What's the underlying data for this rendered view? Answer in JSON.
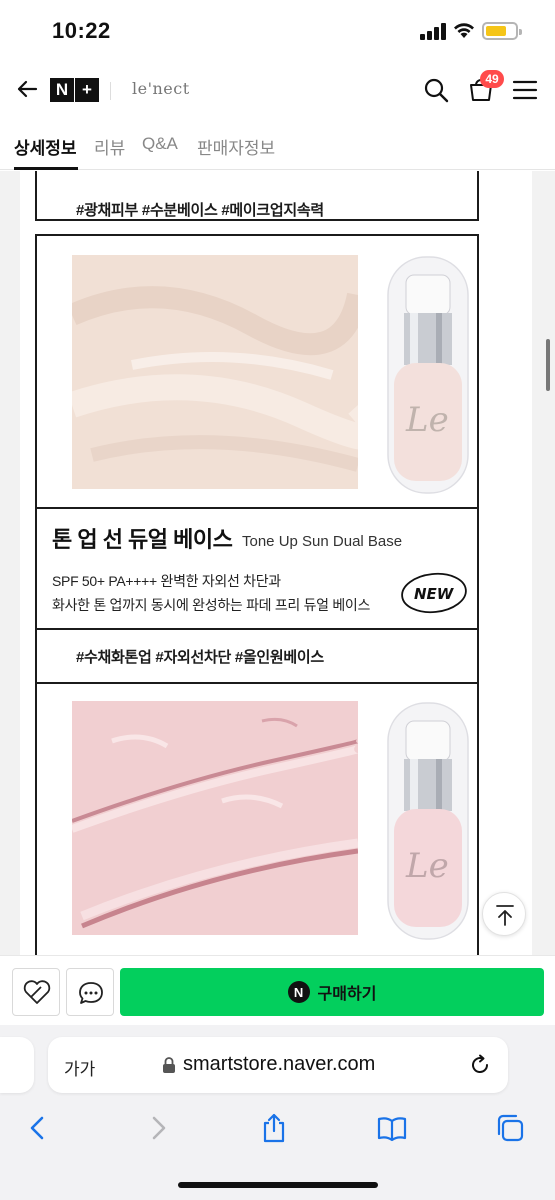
{
  "status_bar": {
    "time": "10:22"
  },
  "header": {
    "brand": "le'nect",
    "cart_count": "49"
  },
  "tabs": [
    {
      "label": "상세정보",
      "active": true
    },
    {
      "label": "리뷰",
      "active": false
    },
    {
      "label": "Q&A",
      "active": false
    },
    {
      "label": "판매자정보",
      "active": false
    }
  ],
  "detail": {
    "hashtags_1": "#광채피부  #수분베이스  #메이크업지속력",
    "product": {
      "title_ko": "톤 업 선 듀얼 베이스",
      "title_en": "Tone Up Sun Dual Base",
      "desc_line1": "SPF 50+ PA++++ 완벽한 자외선 차단과",
      "desc_line2": "화사한 톤 업까지 동시에 완성하는 파데 프리 듀얼 베이스",
      "badge": "NEW"
    },
    "hashtags_2": "#수채화톤업  #자외선차단  #올인원베이스",
    "swatch_colors": {
      "beige": "#f2e1d6",
      "pink": "#f1ced0",
      "bottle_beige": "#f3e0dc",
      "bottle_pink": "#f4d7da"
    }
  },
  "purchase_bar": {
    "buy_label": "구매하기",
    "buy_icon": "N",
    "accent": "#03cf5d"
  },
  "browser": {
    "aa": "가가",
    "url": "smartstore.naver.com"
  }
}
